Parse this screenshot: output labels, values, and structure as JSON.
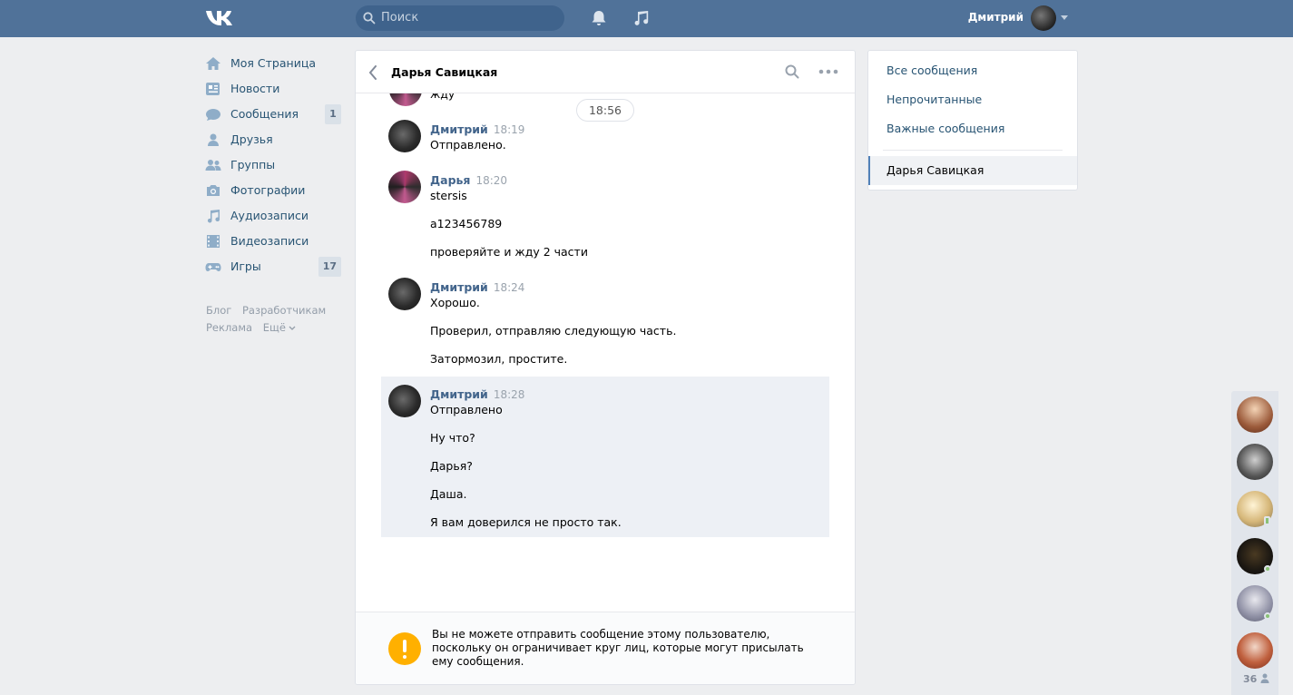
{
  "header": {
    "logo": "vk-logo-icon",
    "search_placeholder": "Поиск",
    "user_name": "Дмитрий"
  },
  "sidebar": {
    "items": [
      {
        "label": "Моя Страница",
        "icon": "home-icon",
        "count": ""
      },
      {
        "label": "Новости",
        "icon": "news-icon",
        "count": ""
      },
      {
        "label": "Сообщения",
        "icon": "messages-icon",
        "count": "1"
      },
      {
        "label": "Друзья",
        "icon": "friends-icon",
        "count": ""
      },
      {
        "label": "Группы",
        "icon": "groups-icon",
        "count": ""
      },
      {
        "label": "Фотографии",
        "icon": "camera-icon",
        "count": ""
      },
      {
        "label": "Аудиозаписи",
        "icon": "music-icon",
        "count": ""
      },
      {
        "label": "Видеозаписи",
        "icon": "video-icon",
        "count": ""
      },
      {
        "label": "Игры",
        "icon": "gamepad-icon",
        "count": "17"
      }
    ],
    "footer": {
      "blog": "Блог",
      "developers": "Разработчикам",
      "ads": "Реклама",
      "more": "Ещё"
    }
  },
  "chat": {
    "title": "Дарья Савицкая",
    "date_pill": "18:56",
    "top_cut_text": "жду",
    "groups": [
      {
        "author": "Дмитрий",
        "time": "18:19",
        "lines": [
          "Отправлено."
        ]
      },
      {
        "author": "Дарья",
        "time": "18:20",
        "lines": [
          "stersis",
          "a123456789",
          "проверяйте и жду 2 части"
        ]
      },
      {
        "author": "Дмитрий",
        "time": "18:24",
        "lines": [
          "Хорошо.",
          "Проверил, отправляю следующую часть.",
          "Затормозил, простите."
        ]
      },
      {
        "author": "Дмитрий",
        "time": "18:28",
        "lines": [
          "Отправлено",
          "Ну что?",
          "Дарья?",
          "Даша.",
          "Я вам доверился не просто так."
        ]
      }
    ],
    "warning": "Вы не можете отправить сообщение этому пользователю, поскольку он ограничивает круг лиц, которые могут присылать ему сообщения."
  },
  "right_panel": {
    "all": "Все сообщения",
    "unread": "Непрочитанные",
    "important": "Важные сообщения",
    "active": "Дарья Савицкая"
  },
  "friends_bar": {
    "count": "36"
  },
  "colors": {
    "header": "#507299",
    "link": "#285473",
    "author": "#42648b",
    "warning": "#ffb000"
  }
}
